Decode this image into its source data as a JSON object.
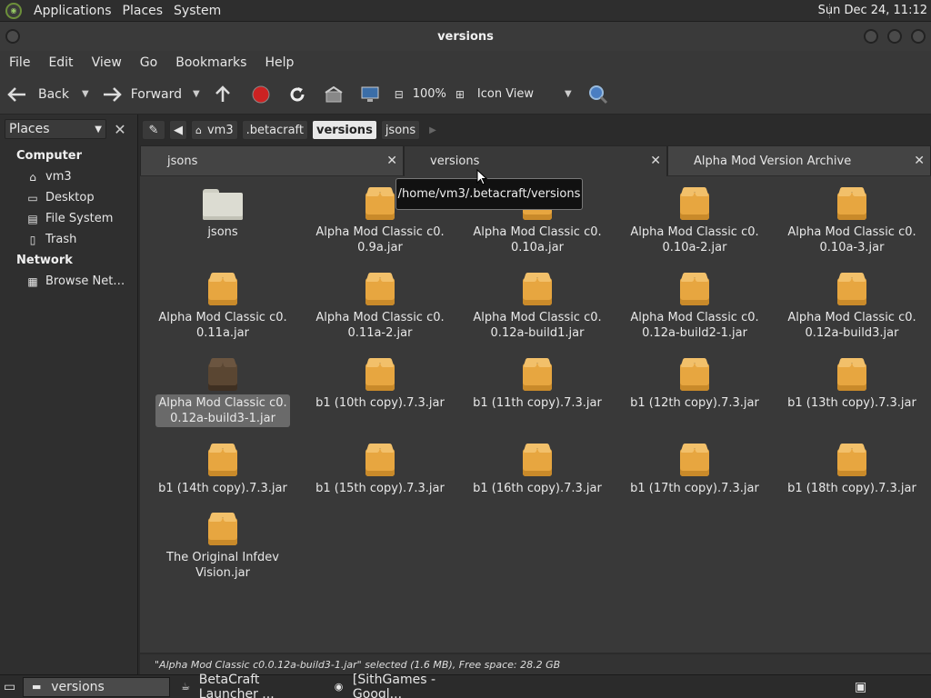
{
  "topbar": {
    "menus": [
      "Applications",
      "Places",
      "System"
    ],
    "clock": "Sun Dec 24, 11:12"
  },
  "window": {
    "title": "versions"
  },
  "menubar": [
    "File",
    "Edit",
    "View",
    "Go",
    "Bookmarks",
    "Help"
  ],
  "toolbar": {
    "back": "Back",
    "forward": "Forward",
    "zoom": "100%",
    "view_mode": "Icon View"
  },
  "pathbar": {
    "crumbs": [
      "vm3",
      ".betacraft",
      "versions",
      "jsons"
    ],
    "active": "versions"
  },
  "sidebar": {
    "header": "Places",
    "sections": [
      {
        "title": "Computer",
        "items": [
          {
            "label": "vm3",
            "icon": "home-folder-icon"
          },
          {
            "label": "Desktop",
            "icon": "desktop-icon"
          },
          {
            "label": "File System",
            "icon": "drive-icon"
          },
          {
            "label": "Trash",
            "icon": "trash-icon"
          }
        ]
      },
      {
        "title": "Network",
        "items": [
          {
            "label": "Browse Net…",
            "icon": "network-icon"
          }
        ]
      }
    ]
  },
  "tabs": [
    {
      "label": "jsons"
    },
    {
      "label": "versions"
    },
    {
      "label": "Alpha Mod Version Archive"
    }
  ],
  "tooltip": "/home/vm3/.betacraft/versions",
  "items": [
    {
      "label": "jsons",
      "type": "folder"
    },
    {
      "label": "Alpha Mod Classic c0.0.9a.jar",
      "type": "jar"
    },
    {
      "label": "Alpha Mod Classic c0.0.10a.jar",
      "type": "jar"
    },
    {
      "label": "Alpha Mod Classic c0.0.10a-2.jar",
      "type": "jar"
    },
    {
      "label": "Alpha Mod Classic c0.0.10a-3.jar",
      "type": "jar"
    },
    {
      "label": "Alpha Mod Classic c0.0.11a.jar",
      "type": "jar"
    },
    {
      "label": "Alpha Mod Classic c0.0.11a-2.jar",
      "type": "jar"
    },
    {
      "label": "Alpha Mod Classic c0.0.12a-build1.jar",
      "type": "jar"
    },
    {
      "label": "Alpha Mod Classic c0.0.12a-build2-1.jar",
      "type": "jar"
    },
    {
      "label": "Alpha Mod Classic c0.0.12a-build3.jar",
      "type": "jar"
    },
    {
      "label": "Alpha Mod Classic c0.0.12a-build3-1.jar",
      "type": "jar",
      "selected": true
    },
    {
      "label": "b1 (10th copy).7.3.jar",
      "type": "jar"
    },
    {
      "label": "b1 (11th copy).7.3.jar",
      "type": "jar"
    },
    {
      "label": "b1 (12th copy).7.3.jar",
      "type": "jar"
    },
    {
      "label": "b1 (13th copy).7.3.jar",
      "type": "jar"
    },
    {
      "label": "b1 (14th copy).7.3.jar",
      "type": "jar"
    },
    {
      "label": "b1 (15th copy).7.3.jar",
      "type": "jar"
    },
    {
      "label": "b1 (16th copy).7.3.jar",
      "type": "jar"
    },
    {
      "label": "b1 (17th copy).7.3.jar",
      "type": "jar"
    },
    {
      "label": "b1 (18th copy).7.3.jar",
      "type": "jar"
    },
    {
      "label": "The Original Infdev Vision.jar",
      "type": "jar"
    }
  ],
  "item_display": [
    [
      "jsons"
    ],
    [
      "Alpha Mod Classic c0.",
      "0.9a.jar"
    ],
    [
      "Alpha Mod Classic c0.",
      "0.10a.jar"
    ],
    [
      "Alpha Mod Classic c0.",
      "0.10a-2.jar"
    ],
    [
      "Alpha Mod Classic c0.",
      "0.10a-3.jar"
    ],
    [
      "Alpha Mod Classic c0.",
      "0.11a.jar"
    ],
    [
      "Alpha Mod Classic c0.",
      "0.11a-2.jar"
    ],
    [
      "Alpha Mod Classic c0.",
      "0.12a-build1.jar"
    ],
    [
      "Alpha Mod Classic c0.",
      "0.12a-build2-1.jar"
    ],
    [
      "Alpha Mod Classic c0.",
      "0.12a-build3.jar"
    ],
    [
      "Alpha Mod Classic c0.",
      "0.12a-build3-1.jar"
    ],
    [
      "b1 (10th copy).7.3.jar"
    ],
    [
      "b1 (11th copy).7.3.jar"
    ],
    [
      "b1 (12th copy).7.3.jar"
    ],
    [
      "b1 (13th copy).7.3.jar"
    ],
    [
      "b1 (14th copy).7.3.jar"
    ],
    [
      "b1 (15th copy).7.3.jar"
    ],
    [
      "b1 (16th copy).7.3.jar"
    ],
    [
      "b1 (17th copy).7.3.jar"
    ],
    [
      "b1 (18th copy).7.3.jar"
    ],
    [
      "The Original Infdev",
      "Vision.jar"
    ]
  ],
  "status": "\"Alpha Mod Classic c0.0.12a-build3-1.jar\" selected (1.6 MB), Free space: 28.2 GB",
  "taskbar": [
    {
      "label": "versions",
      "icon": "folder-icon",
      "active": true
    },
    {
      "label": "BetaCraft Launcher ...",
      "icon": "java-icon",
      "active": false
    },
    {
      "label": "[SithGames - Googl...",
      "icon": "chrome-icon",
      "active": false
    }
  ],
  "colors": {
    "accent": "#e7a640",
    "background": "#393939",
    "selection": "#6a6a6a"
  }
}
